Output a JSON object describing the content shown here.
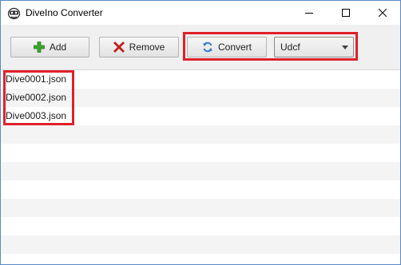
{
  "window": {
    "title": "DiveIno Converter",
    "app_icon": "diveino-logo-icon",
    "controls": [
      "minimize-icon",
      "maximize-icon",
      "close-icon"
    ]
  },
  "toolbar": {
    "add_label": "Add",
    "remove_label": "Remove",
    "convert_label": "Convert",
    "format_selected": "Udcf"
  },
  "file_list": {
    "items": [
      "Dive0001.json",
      "Dive0002.json",
      "Dive0003.json"
    ]
  },
  "colors": {
    "highlight": "#e0202a",
    "add_icon": "#3aa52c",
    "remove_icon": "#d6201f",
    "convert_icon": "#2f7bd6",
    "row_alt": "#f4f4f4"
  }
}
